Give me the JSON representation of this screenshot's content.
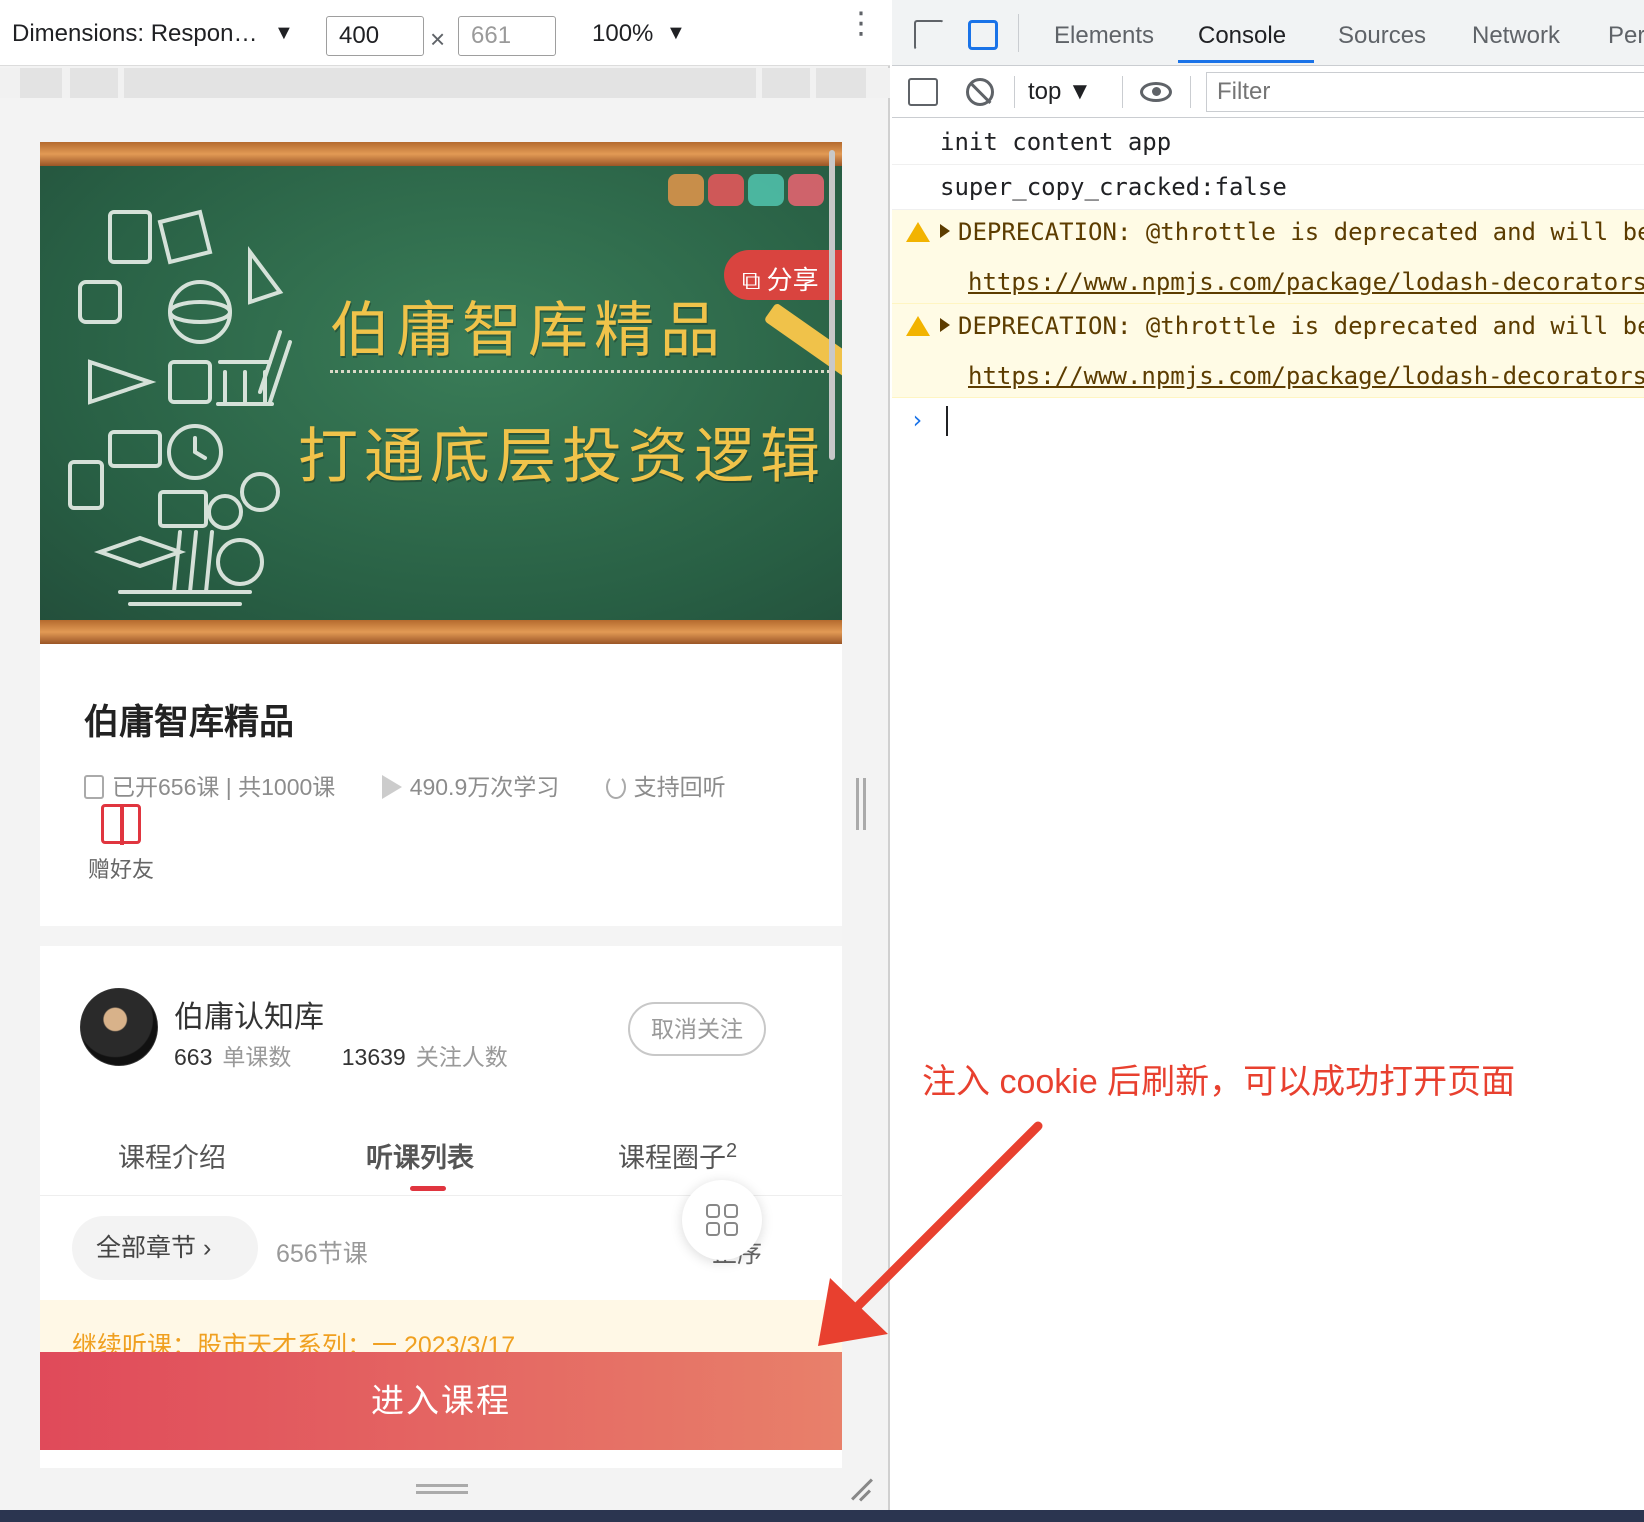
{
  "device_toolbar": {
    "dimensions_label": "Dimensions: Respon…",
    "width_value": "400",
    "height_value": "661",
    "times_symbol": "×",
    "zoom_label": "100%",
    "caret": "▼",
    "kebab": "⋮"
  },
  "banner": {
    "headline_1": "伯庸智库精品",
    "headline_2": "打通底层投资逻辑",
    "share_label": "分享",
    "share_icon": "external-link-icon"
  },
  "course": {
    "title": "伯庸智库精品",
    "lessons_info": "已开656课 | 共1000课",
    "plays_info": "490.9万次学习",
    "replay_info": "支持回听",
    "gift_label": "赠好友"
  },
  "author": {
    "name": "伯庸认知库",
    "lesson_count": "663",
    "lesson_count_label": "单课数",
    "follower_count": "13639",
    "follower_count_label": "关注人数",
    "unfollow_label": "取消关注"
  },
  "tabs": {
    "intro": "课程介绍",
    "list": "听课列表",
    "circle": "课程圈子",
    "circle_count": "2"
  },
  "chapters": {
    "all_label": "全部章节",
    "lesson_total": "656节课",
    "sort_label": "正序"
  },
  "continue_bar": "继续听课：股市天才系列：一 2023/3/17",
  "enter_button": "进入课程",
  "devtools": {
    "tabs": [
      "Elements",
      "Console",
      "Sources",
      "Network",
      "Per"
    ],
    "active_tab": "Console",
    "context": "top",
    "filter_placeholder": "Filter",
    "logs": [
      {
        "level": "info",
        "text": "init content app"
      },
      {
        "level": "info",
        "text": "super_copy_cracked:false"
      },
      {
        "level": "warn",
        "text": "DEPRECATION: @throttle is deprecated and will be",
        "link": "https://www.npmjs.com/package/lodash-decorators"
      },
      {
        "level": "warn",
        "text": "DEPRECATION: @throttle is deprecated and will be",
        "link": "https://www.npmjs.com/package/lodash-decorators"
      }
    ],
    "prompt": "›"
  },
  "annotation": "注入 cookie 后刷新，可以成功打开页面",
  "colors": {
    "accent_red": "#e0353f",
    "devtools_blue": "#1a73e8",
    "annotation_red": "#e8402f",
    "chalkboard_green": "#2c6b4a",
    "headline_gold": "#f0c34a"
  }
}
